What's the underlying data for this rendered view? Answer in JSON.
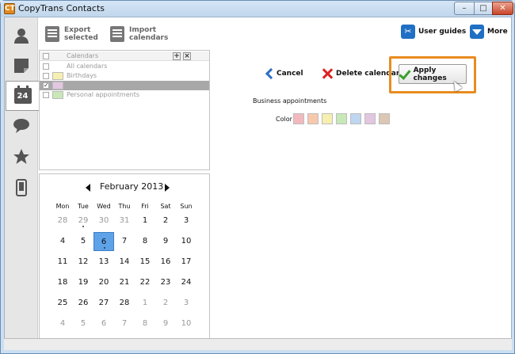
{
  "window": {
    "title": "CopyTrans Contacts",
    "app_icon": "CT",
    "controls": {
      "minimize": "–",
      "maximize": "□",
      "close": "✕"
    }
  },
  "nav": [
    {
      "name": "contacts",
      "icon": "person-icon"
    },
    {
      "name": "notes",
      "icon": "note-icon"
    },
    {
      "name": "calendars",
      "icon": "calendar-icon",
      "label": "24",
      "active": true
    },
    {
      "name": "messages",
      "icon": "speech-bubble-icon"
    },
    {
      "name": "favorites",
      "icon": "star-icon"
    },
    {
      "name": "devices",
      "icon": "phone-icon"
    }
  ],
  "toolbar": {
    "export_line1": "Export",
    "export_line2": "selected",
    "import_line1": "Import",
    "import_line2": "calendars",
    "user_guides": "User guides",
    "more": "More"
  },
  "calendars": {
    "header": "Calendars",
    "rows": [
      {
        "label": "All calendars",
        "color": "",
        "checked": false
      },
      {
        "label": "Birthdays",
        "color": "#f6efb0",
        "checked": false
      },
      {
        "label": "",
        "color": "#e3c6e0",
        "checked": true,
        "selected": true
      },
      {
        "label": "Personal appointments",
        "color": "#c8e8b8",
        "checked": false
      }
    ]
  },
  "month": {
    "label": "February 2013",
    "weekdays": [
      "Mon",
      "Tue",
      "Wed",
      "Thu",
      "Fri",
      "Sat",
      "Sun"
    ],
    "weeks": [
      [
        "28",
        "29",
        "30",
        "31",
        "1",
        "2",
        "3"
      ],
      [
        "4",
        "5",
        "6",
        "7",
        "8",
        "9",
        "10"
      ],
      [
        "11",
        "12",
        "13",
        "14",
        "15",
        "16",
        "17"
      ],
      [
        "18",
        "19",
        "20",
        "21",
        "22",
        "23",
        "24"
      ],
      [
        "25",
        "26",
        "27",
        "28",
        "1",
        "2",
        "3"
      ],
      [
        "4",
        "5",
        "6",
        "7",
        "8",
        "9",
        "10"
      ]
    ],
    "today": "6"
  },
  "actions": {
    "cancel": "Cancel",
    "delete": "Delete calendar",
    "apply": "Apply changes"
  },
  "editor": {
    "name_label": "Business appointments",
    "color_label": "Color",
    "colors": [
      "#f2b9bd",
      "#f8c8ac",
      "#f6efb0",
      "#c8e8b8",
      "#bed6ef",
      "#e3c6e0",
      "#dcc6b4"
    ]
  }
}
